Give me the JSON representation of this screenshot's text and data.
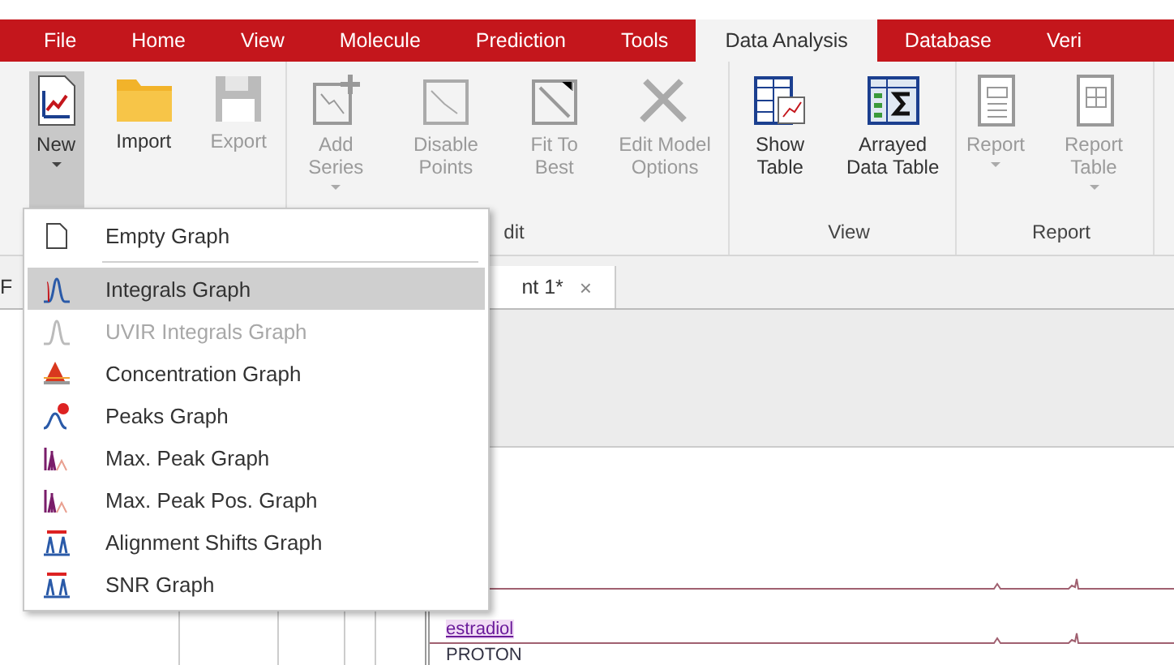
{
  "menu_tabs": [
    {
      "label": "File",
      "selected": false
    },
    {
      "label": "Home",
      "selected": false
    },
    {
      "label": "View",
      "selected": false
    },
    {
      "label": "Molecule",
      "selected": false
    },
    {
      "label": "Prediction",
      "selected": false
    },
    {
      "label": "Tools",
      "selected": false
    },
    {
      "label": "Data Analysis",
      "selected": true
    },
    {
      "label": "Database",
      "selected": false
    },
    {
      "label": "Veri",
      "selected": false
    }
  ],
  "ribbon_groups": [
    {
      "buttons": [
        {
          "label": "New",
          "disabled": false,
          "pressed": true,
          "dropdown": true
        },
        {
          "label": "Import",
          "disabled": false,
          "pressed": false,
          "dropdown": false
        },
        {
          "label": "Export",
          "disabled": true,
          "pressed": false,
          "dropdown": false
        }
      ]
    },
    {
      "label": "dit",
      "buttons": [
        {
          "label": "Add Series",
          "disabled": true,
          "pressed": false,
          "dropdown": true
        },
        {
          "label": "Disable Points",
          "disabled": true,
          "pressed": false,
          "dropdown": false
        },
        {
          "label": "Fit To Best",
          "disabled": true,
          "pressed": false,
          "dropdown": false
        },
        {
          "label": "Edit Model Options",
          "disabled": true,
          "pressed": false,
          "dropdown": false
        }
      ]
    },
    {
      "label": "View",
      "buttons": [
        {
          "label": "Show Table",
          "disabled": false,
          "pressed": false,
          "dropdown": false
        },
        {
          "label": "Arrayed Data Table",
          "disabled": false,
          "pressed": false,
          "dropdown": false
        }
      ]
    },
    {
      "label": "Report",
      "buttons": [
        {
          "label": "Report",
          "disabled": true,
          "pressed": false,
          "dropdown": true
        },
        {
          "label": "Report Table",
          "disabled": true,
          "pressed": false,
          "dropdown": true
        }
      ]
    }
  ],
  "doc_tabs": [
    {
      "label": "F",
      "selected": false
    },
    {
      "label": "nt 1*",
      "selected": true,
      "close": "×"
    }
  ],
  "traces": [
    {
      "label": "estradiol"
    },
    {
      "label": "PROTON"
    }
  ],
  "new_menu": {
    "sections": [
      [
        {
          "label": "Empty Graph",
          "selected": false,
          "disabled": false
        }
      ],
      [
        {
          "label": "Integrals Graph",
          "selected": true,
          "disabled": false
        },
        {
          "label": "UVIR Integrals Graph",
          "selected": false,
          "disabled": true
        },
        {
          "label": "Concentration Graph",
          "selected": false,
          "disabled": false
        },
        {
          "label": "Peaks Graph",
          "selected": false,
          "disabled": false
        },
        {
          "label": "Max. Peak Graph",
          "selected": false,
          "disabled": false
        },
        {
          "label": "Max. Peak Pos. Graph",
          "selected": false,
          "disabled": false
        },
        {
          "label": "Alignment Shifts Graph",
          "selected": false,
          "disabled": false
        },
        {
          "label": "SNR Graph",
          "selected": false,
          "disabled": false
        }
      ]
    ]
  }
}
